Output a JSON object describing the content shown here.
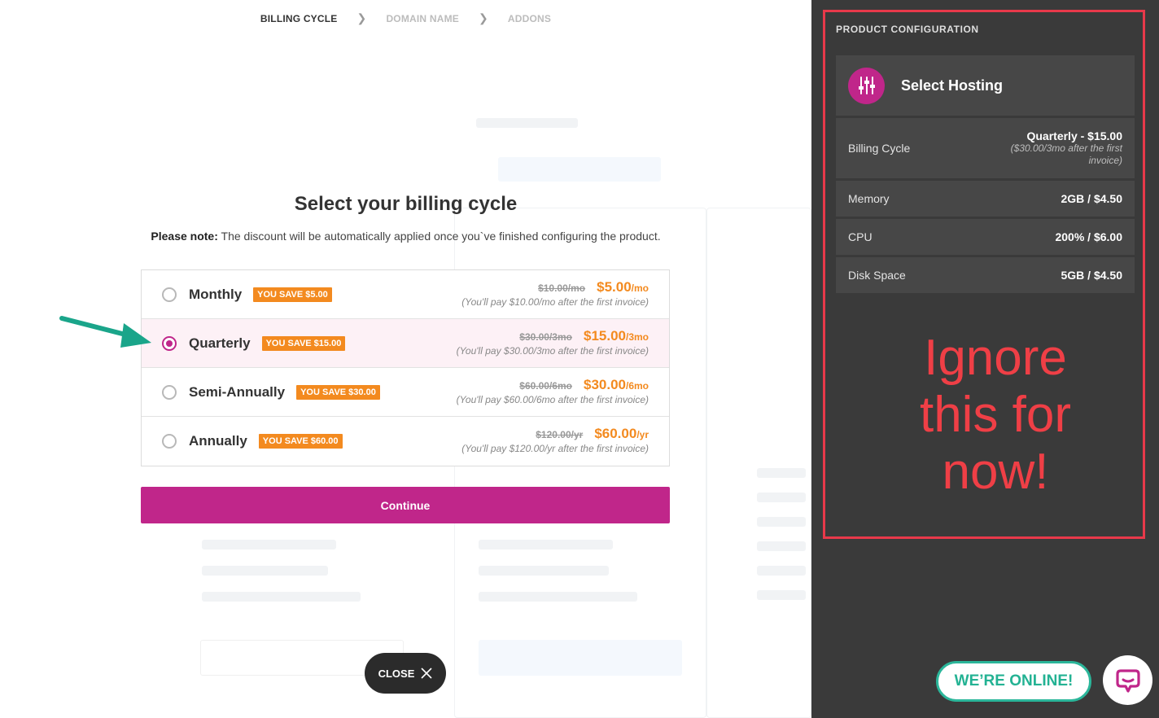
{
  "steps": [
    {
      "label": "BILLING CYCLE"
    },
    {
      "label": "DOMAIN NAME"
    },
    {
      "label": "ADDONS"
    }
  ],
  "heading": "Select your billing cycle",
  "note": {
    "bold": "Please note:",
    "text": "The discount will be automatically applied once you`ve finished configuring the product."
  },
  "options": [
    {
      "name": "Monthly",
      "badge": "YOU SAVE $5.00",
      "old": "$10.00/mo",
      "new": "$5.00",
      "unit": "/mo",
      "note": "(You'll pay $10.00/mo after the first invoice)",
      "selected": false
    },
    {
      "name": "Quarterly",
      "badge": "YOU SAVE $15.00",
      "old": "$30.00/3mo",
      "new": "$15.00",
      "unit": "/3mo",
      "note": "(You'll pay $30.00/3mo after the first invoice)",
      "selected": true
    },
    {
      "name": "Semi-Annually",
      "badge": "YOU SAVE $30.00",
      "old": "$60.00/6mo",
      "new": "$30.00",
      "unit": "/6mo",
      "note": "(You'll pay $60.00/6mo after the first invoice)",
      "selected": false
    },
    {
      "name": "Annually",
      "badge": "YOU SAVE $60.00",
      "old": "$120.00/yr",
      "new": "$60.00",
      "unit": "/yr",
      "note": "(You'll pay $120.00/yr after the first invoice)",
      "selected": false
    }
  ],
  "continue_label": "Continue",
  "close_label": "CLOSE",
  "sidebar": {
    "title": "PRODUCT CONFIGURATION",
    "card_title": "Select Hosting",
    "rows": [
      {
        "label": "Billing Cycle",
        "value": "Quarterly - $15.00",
        "sub": "($30.00/3mo after the first invoice)"
      },
      {
        "label": "Memory",
        "value": "2GB / $4.50"
      },
      {
        "label": "CPU",
        "value": "200% / $6.00"
      },
      {
        "label": "Disk Space",
        "value": "5GB / $4.50"
      }
    ],
    "annotation": [
      "Ignore",
      "this for",
      "now!"
    ]
  },
  "online_label": "WE’RE ONLINE!",
  "colors": {
    "accent": "#c0268a",
    "badge": "#f38a1f",
    "annotation": "#ef3f46",
    "online": "#2bb69a",
    "arrow": "#1aa58a"
  }
}
